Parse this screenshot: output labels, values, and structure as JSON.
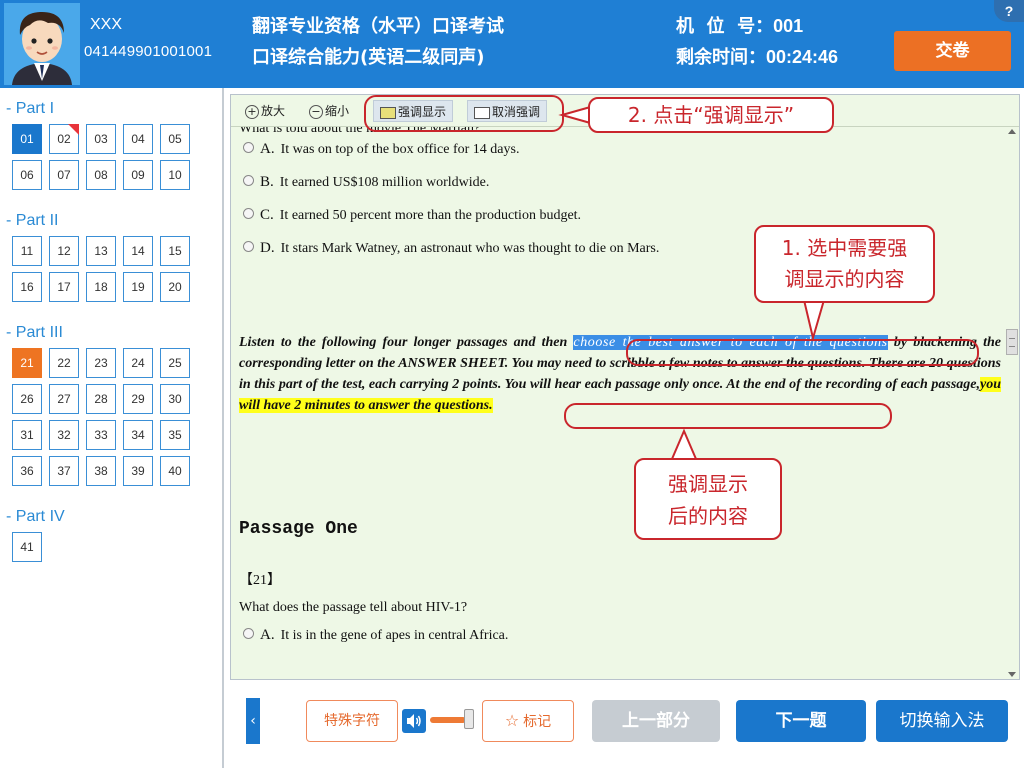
{
  "header": {
    "user_name": "XXX",
    "user_id": "041449901001001",
    "exam_title": "翻译专业资格（水平）口译考试",
    "exam_subtitle": "口译综合能力(英语二级同声)",
    "seat_label": "机  位  号：",
    "seat_number": "001",
    "time_label": "剩余时间：",
    "time_remaining": "00:24:46",
    "submit_label": "交卷",
    "help_label": "?"
  },
  "sidebar": {
    "parts": [
      {
        "title": "- Part I",
        "questions": [
          "01",
          "02",
          "03",
          "04",
          "05",
          "06",
          "07",
          "08",
          "09",
          "10"
        ]
      },
      {
        "title": "- Part II",
        "questions": [
          "11",
          "12",
          "13",
          "14",
          "15",
          "16",
          "17",
          "18",
          "19",
          "20"
        ]
      },
      {
        "title": "- Part III",
        "questions": [
          "21",
          "22",
          "23",
          "24",
          "25",
          "26",
          "27",
          "28",
          "29",
          "30",
          "31",
          "32",
          "33",
          "34",
          "35",
          "36",
          "37",
          "38",
          "39",
          "40"
        ]
      },
      {
        "title": "- Part IV",
        "questions": [
          "41"
        ]
      }
    ],
    "current_question": "01",
    "flagged_question": "02",
    "active_question": "21"
  },
  "toolbar": {
    "zoom_in": "放大",
    "zoom_out": "缩小",
    "highlight": "强调显示",
    "cancel_highlight": "取消强调"
  },
  "content": {
    "question_intro": "What is told about the movie The Martian?",
    "options": [
      {
        "letter": "A.",
        "text": "It was on top of the box office for 14 days."
      },
      {
        "letter": "B.",
        "text": "It earned US$108 million worldwide."
      },
      {
        "letter": "C.",
        "text": "It earned 50 percent more than the production budget."
      },
      {
        "letter": "D.",
        "text": "It stars Mark Watney, an astronaut who was thought to die on Mars."
      }
    ],
    "instructions_part1": "Listen to the following four longer passages and then ",
    "instructions_selected": "choose the best answer to each of the questions",
    "instructions_part2": " by blackening the corresponding letter on the ANSWER SHEET. You may need to scribble a few notes to answer the questions. There are 20 questions in this part of the test, each carrying 2 points. You will hear each passage only once. At the end of the recording of each passage,",
    "instructions_highlighted": "you will have 2 minutes to answer the questions.",
    "passage_title": "Passage One",
    "question_number": "【21】",
    "question_text": "What does the passage tell about HIV-1?",
    "question_option_a_letter": "A.",
    "question_option_a": "It is in the gene of apes in central Africa."
  },
  "callouts": {
    "step2": "2. 点击“强调显示”",
    "step1_line1": "1. 选中需要强",
    "step1_line2": "调显示的内容",
    "result_line1": "强调显示",
    "result_line2": "后的内容"
  },
  "bottom": {
    "special_chars": "特殊字符",
    "mark": "标记",
    "prev_section": "上一部分",
    "next_question": "下一题",
    "switch_input": "切换输入法",
    "prev_arrow": "‹"
  },
  "colors": {
    "header_bg": "#1f7fd4",
    "submit_bg": "#ec7024",
    "content_bg": "#eef8e6",
    "selection": "#3b8ee6",
    "highlight": "#ffff1a",
    "callout_red": "#c9262c"
  }
}
